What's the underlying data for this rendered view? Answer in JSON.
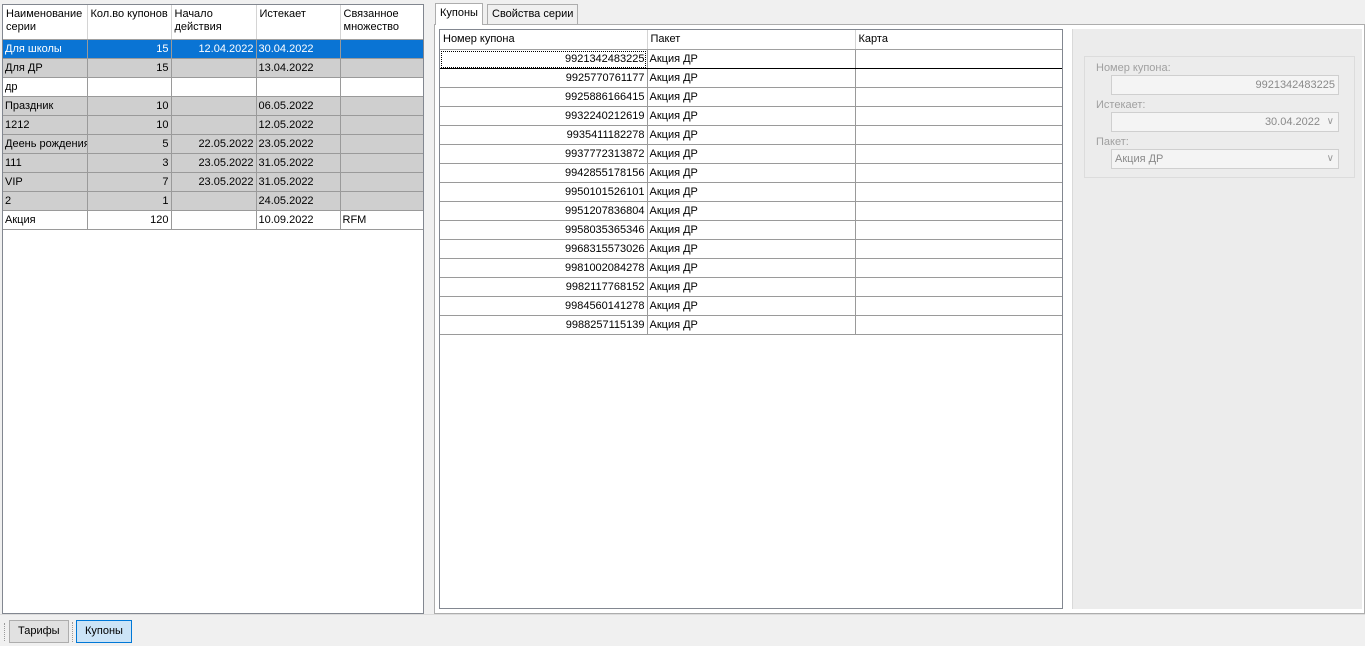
{
  "series_table": {
    "columns": [
      "Наименование серии",
      "Кол.во купонов",
      "Начало действия",
      "Истекает",
      "Связанное множество"
    ],
    "rows": [
      {
        "name": "Для школы",
        "count": "15",
        "start": "12.04.2022",
        "expires": "30.04.2022",
        "set": "",
        "style": "sel"
      },
      {
        "name": "Для ДР",
        "count": "15",
        "start": "",
        "expires": "13.04.2022",
        "set": "",
        "style": "grey"
      },
      {
        "name": "др",
        "count": "",
        "start": "",
        "expires": "",
        "set": "",
        "style": "white"
      },
      {
        "name": "Праздник",
        "count": "10",
        "start": "",
        "expires": "06.05.2022",
        "set": "",
        "style": "grey"
      },
      {
        "name": "1212",
        "count": "10",
        "start": "",
        "expires": "12.05.2022",
        "set": "",
        "style": "grey"
      },
      {
        "name": "Деень рождения",
        "count": "5",
        "start": "22.05.2022",
        "expires": "23.05.2022",
        "set": "",
        "style": "grey"
      },
      {
        "name": "111",
        "count": "3",
        "start": "23.05.2022",
        "expires": "31.05.2022",
        "set": "",
        "style": "grey"
      },
      {
        "name": "VIP",
        "count": "7",
        "start": "23.05.2022",
        "expires": "31.05.2022",
        "set": "",
        "style": "grey"
      },
      {
        "name": "2",
        "count": "1",
        "start": "",
        "expires": "24.05.2022",
        "set": "",
        "style": "grey"
      },
      {
        "name": "Акция",
        "count": "120",
        "start": "",
        "expires": "10.09.2022",
        "set": "RFM",
        "style": "white"
      }
    ]
  },
  "tabs": [
    {
      "label": "Купоны",
      "active": true
    },
    {
      "label": "Свойства серии",
      "active": false
    }
  ],
  "coupons_table": {
    "columns": [
      "Номер купона",
      "Пакет",
      "Карта"
    ],
    "rows": [
      {
        "number": "9921342483225",
        "package": "Акция ДР",
        "card": ""
      },
      {
        "number": "9925770761177",
        "package": "Акция ДР",
        "card": ""
      },
      {
        "number": "9925886166415",
        "package": "Акция ДР",
        "card": ""
      },
      {
        "number": "9932240212619",
        "package": "Акция ДР",
        "card": ""
      },
      {
        "number": "9935411182278",
        "package": "Акция ДР",
        "card": ""
      },
      {
        "number": "9937772313872",
        "package": "Акция ДР",
        "card": ""
      },
      {
        "number": "9942855178156",
        "package": "Акция ДР",
        "card": ""
      },
      {
        "number": "9950101526101",
        "package": "Акция ДР",
        "card": ""
      },
      {
        "number": "9951207836804",
        "package": "Акция ДР",
        "card": ""
      },
      {
        "number": "9958035365346",
        "package": "Акция ДР",
        "card": ""
      },
      {
        "number": "9968315573026",
        "package": "Акция ДР",
        "card": ""
      },
      {
        "number": "9981002084278",
        "package": "Акция ДР",
        "card": ""
      },
      {
        "number": "9982117768152",
        "package": "Акция ДР",
        "card": ""
      },
      {
        "number": "9984560141278",
        "package": "Акция ДР",
        "card": ""
      },
      {
        "number": "9988257115139",
        "package": "Акция ДР",
        "card": ""
      }
    ]
  },
  "details": {
    "coupon_number_label": "Номер купона:",
    "coupon_number_value": "9921342483225",
    "expires_label": "Истекает:",
    "expires_value": "30.04.2022",
    "package_label": "Пакет:",
    "package_value": "Акция ДР"
  },
  "bottom_bar": {
    "tariffs_label": "Тарифы",
    "coupons_label": "Купоны"
  },
  "colors": {
    "selection": "#0a74d4",
    "row_grey": "#cfcfcf",
    "active_button": "#cce4f7"
  }
}
